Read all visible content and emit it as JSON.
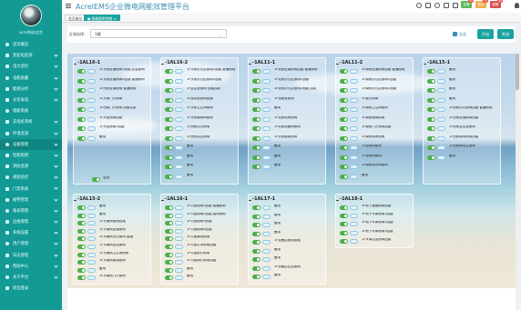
{
  "app": {
    "title": "AcrelEMS企业微电网能效管理平台",
    "username": "acrel科技北京"
  },
  "sidebar": {
    "items": [
      {
        "label": "首页概览",
        "chev": false
      },
      {
        "label": "变配电监测",
        "chev": true
      },
      {
        "label": "电力监控",
        "chev": true
      },
      {
        "label": "电能质量",
        "chev": true
      },
      {
        "label": "能耗分析",
        "chev": true
      },
      {
        "label": "光伏发电",
        "chev": true
      },
      {
        "label": "储能系统",
        "chev": false
      },
      {
        "label": "充电桩系统",
        "chev": true
      },
      {
        "label": "环境监测",
        "chev": true
      },
      {
        "label": "设备管理",
        "chev": true
      },
      {
        "label": "智能照明",
        "chev": true
      },
      {
        "label": "消防监测",
        "chev": true
      },
      {
        "label": "视频监控",
        "chev": true
      },
      {
        "label": "门禁系统",
        "chev": true
      },
      {
        "label": "报警管理",
        "chev": true
      },
      {
        "label": "报表管理",
        "chev": true
      },
      {
        "label": "运维管理",
        "chev": true
      },
      {
        "label": "系统设置",
        "chev": true
      },
      {
        "label": "用户管理",
        "chev": true
      },
      {
        "label": "日志管理",
        "chev": true
      },
      {
        "label": "帮助中心",
        "chev": true
      },
      {
        "label": "关于平台",
        "chev": true
      },
      {
        "label": "退出登录",
        "chev": false
      }
    ],
    "active_index": 9
  },
  "topbar": {
    "badges": [
      {
        "label": "告警",
        "count": "99",
        "color": "#5cb85c"
      },
      {
        "label": "提示",
        "count": "12",
        "color": "#f0ad4e"
      },
      {
        "label": "报警",
        "count": "99",
        "color": "#d9534f"
      }
    ]
  },
  "tabs": [
    {
      "label": "首页概览",
      "active": false
    },
    {
      "label": "● 智能照明控制 ×",
      "active": true
    }
  ],
  "filter": {
    "label": "区域选择：",
    "value": "1楼",
    "checkbox_label": "全选",
    "btn_open": "开启",
    "btn_close": "关闭"
  },
  "panels": [
    {
      "title": "-1AL16-1",
      "rows": [
        "1F东侧走道照明1回路 应急照明",
        "1F东侧走道照明2回路 普通照明",
        "1F西侧走道照明 普通照明",
        "1F东侧门厅照明",
        "1F西侧门厅照明 回路控制",
        "1F大堂照明回路",
        "1F大堂照明2回路",
        "备用"
      ]
    },
    {
      "title": "-1AL16-2",
      "rows": [
        "1F东侧办公区照明1回路 普通照明",
        "1F东侧办公区照明2回路",
        "1F会议室照明 回路控制",
        "1F接待室照明回路",
        "1F东侧卫生间照明",
        "1F东侧楼梯间照明",
        "1F西侧办公照明",
        "1F西侧会议照明",
        "备用",
        "备用",
        "备用",
        "备用"
      ]
    },
    {
      "title": "-1AL11-1",
      "rows": [
        "1F北侧走道照明回路 普通照明",
        "1F北侧办公区照明1回路",
        "1F北侧办公区照明2回路 控制",
        "1F档案室照明",
        "备用",
        "1F北侧机房照明",
        "1F北侧设备间照明",
        "1F北侧楼梯照明",
        "备用",
        "备用",
        "备用"
      ]
    },
    {
      "title": "-1AL11-2",
      "rows": [
        "1F南侧走道照明回路 普通照明",
        "1F南侧办公区照明1回路",
        "1F南侧办公区照明2回路",
        "1F展厅照明",
        "1F南侧卫生间照明",
        "1F南侧楼梯照明",
        "1F南侧门厅照明回路",
        "1F南侧库房照明",
        "1F弱电间照明",
        "1F强电间照明",
        "1F南侧茶水间照明",
        "备用"
      ]
    },
    {
      "title": "-1AL15-1",
      "rows": [
        "备用",
        "备用",
        "备用",
        "备用",
        "1F西侧办公照明回路 普通照明",
        "1F西侧走道照明回路",
        "1F西侧会议室照明",
        "1F西侧接待照明回路",
        "1F西侧休息区照明",
        "备用"
      ]
    },
    {
      "title": "-1AL15-2",
      "rows": [
        "备用",
        "备用",
        "1F东南侧照明回路",
        "1F东南侧走道照明",
        "1F东南侧办公照明 普通",
        "1F东南侧会议照明",
        "1F东南侧卫生间照明",
        "1F东南侧楼梯照明",
        "备用",
        "1F东南侧门厅照明"
      ]
    },
    {
      "title": "-1AL16-1",
      "rows": [
        "1F中庭照明1回路 普通照明",
        "1F中庭照明2回路 装饰照明",
        "1F中庭照明3回路",
        "1F中庭照明4回路",
        "1F中庭景观照明",
        "1F中庭灯带照明回路",
        "1F中庭射灯照明",
        "1F中庭筒灯照明回路",
        "备用",
        "备用"
      ]
    },
    {
      "title": "-1AL17-1",
      "rows": [
        "备用",
        "备用",
        "备用",
        "备用",
        "1F设备层照明回路",
        "备用",
        "备用",
        "1F设备层应急照明",
        "备用"
      ]
    },
    {
      "title": "-1AL18-1",
      "rows": [
        "1F地下通道照明回路",
        "1F地下车库照明1回路",
        "1F地下车库照明2回路",
        "1F地下车库照明3回路",
        "1F车库应急照明回路"
      ]
    }
  ],
  "panel1_footer": "全选"
}
